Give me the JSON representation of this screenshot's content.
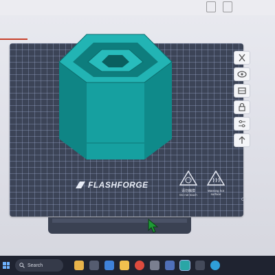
{
  "plate": {
    "brand": "FLASHFORGE",
    "warning_no_touch_zh": "请勿触摸",
    "warning_no_touch_en": "Do not touch",
    "warning_hot_en": "Warning hot surface",
    "corner_mark": "C1"
  },
  "side_tools": [
    {
      "icon": "close-icon"
    },
    {
      "icon": "eye-icon"
    },
    {
      "icon": "layers-icon"
    },
    {
      "icon": "lock-icon"
    },
    {
      "icon": "sliders-icon"
    },
    {
      "icon": "upload-icon"
    }
  ],
  "taskbar": {
    "search_label": "Search",
    "apps": [
      "file-explorer-icon",
      "camera-icon",
      "mail-icon",
      "folder-icon",
      "chrome-icon",
      "settings-icon",
      "store-icon",
      "flashprint-icon",
      "terminal-icon",
      "edge-icon"
    ]
  },
  "colors": {
    "model_teal": "#1aa5a5",
    "plate_dark": "#3c4457"
  }
}
